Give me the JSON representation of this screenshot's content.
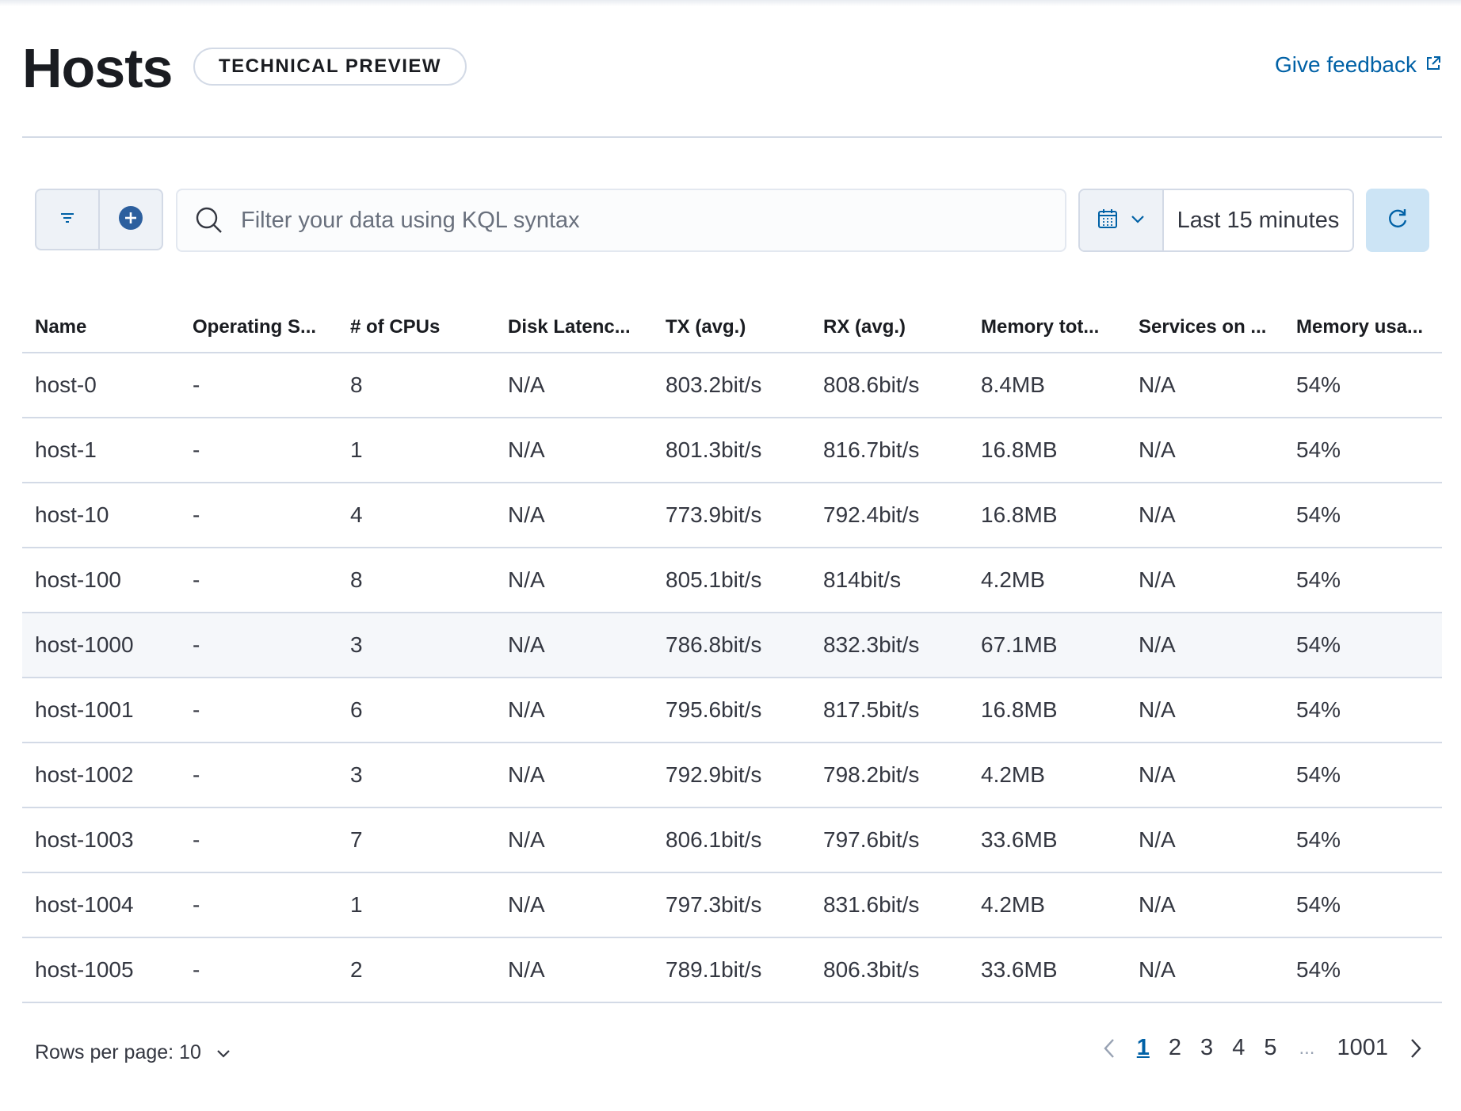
{
  "page": {
    "title": "Hosts",
    "badge": "TECHNICAL PREVIEW",
    "feedback_label": "Give feedback"
  },
  "toolbar": {
    "search_placeholder": "Filter your data using KQL syntax",
    "time_range": "Last 15 minutes"
  },
  "table": {
    "columns": [
      "Name",
      "Operating S...",
      "# of CPUs",
      "Disk Latenc...",
      "TX (avg.)",
      "RX (avg.)",
      "Memory tot...",
      "Services on ...",
      "Memory usa..."
    ],
    "rows": [
      [
        "host-0",
        "-",
        "8",
        "N/A",
        "803.2bit/s",
        "808.6bit/s",
        "8.4MB",
        "N/A",
        "54%"
      ],
      [
        "host-1",
        "-",
        "1",
        "N/A",
        "801.3bit/s",
        "816.7bit/s",
        "16.8MB",
        "N/A",
        "54%"
      ],
      [
        "host-10",
        "-",
        "4",
        "N/A",
        "773.9bit/s",
        "792.4bit/s",
        "16.8MB",
        "N/A",
        "54%"
      ],
      [
        "host-100",
        "-",
        "8",
        "N/A",
        "805.1bit/s",
        "814bit/s",
        "4.2MB",
        "N/A",
        "54%"
      ],
      [
        "host-1000",
        "-",
        "3",
        "N/A",
        "786.8bit/s",
        "832.3bit/s",
        "67.1MB",
        "N/A",
        "54%"
      ],
      [
        "host-1001",
        "-",
        "6",
        "N/A",
        "795.6bit/s",
        "817.5bit/s",
        "16.8MB",
        "N/A",
        "54%"
      ],
      [
        "host-1002",
        "-",
        "3",
        "N/A",
        "792.9bit/s",
        "798.2bit/s",
        "4.2MB",
        "N/A",
        "54%"
      ],
      [
        "host-1003",
        "-",
        "7",
        "N/A",
        "806.1bit/s",
        "797.6bit/s",
        "33.6MB",
        "N/A",
        "54%"
      ],
      [
        "host-1004",
        "-",
        "1",
        "N/A",
        "797.3bit/s",
        "831.6bit/s",
        "4.2MB",
        "N/A",
        "54%"
      ],
      [
        "host-1005",
        "-",
        "2",
        "N/A",
        "789.1bit/s",
        "806.3bit/s",
        "33.6MB",
        "N/A",
        "54%"
      ]
    ]
  },
  "pagination": {
    "rows_per_page_label": "Rows per page: 10",
    "pages": [
      "1",
      "2",
      "3",
      "4",
      "5"
    ],
    "ellipsis": "...",
    "last_page": "1001",
    "current_page": "1"
  },
  "icons": {
    "filter": "filter-icon",
    "add": "plus-circle-icon",
    "search": "search-icon",
    "calendar": "calendar-icon",
    "refresh": "refresh-icon",
    "external": "external-link-icon"
  },
  "colors": {
    "accent": "#0061a6",
    "accent_fill": "#2c5f9e",
    "border": "#d3dae6",
    "refresh_bg": "#cce4f5"
  }
}
